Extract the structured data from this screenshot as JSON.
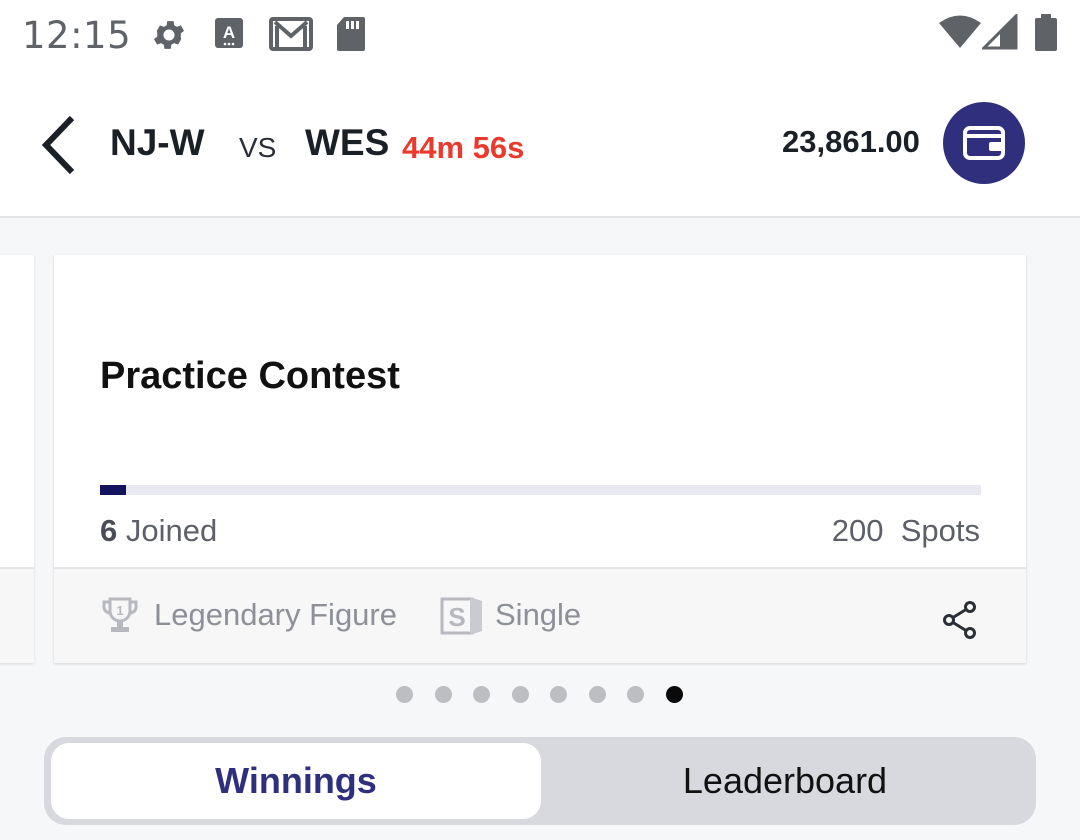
{
  "status_bar": {
    "time": "12:15",
    "icons": [
      "settings-icon",
      "keyboard-a-icon",
      "gmail-icon",
      "sd-card-icon",
      "wifi-icon",
      "signal-icon",
      "battery-icon"
    ]
  },
  "header": {
    "team_home": "NJ-W",
    "vs": "VS",
    "team_away": "WES",
    "countdown": "44m 56s",
    "balance": "23,861.00",
    "back_icon": "chevron-left-icon",
    "wallet_icon": "wallet-icon"
  },
  "contest": {
    "title": "Practice Contest",
    "joined_count": "6",
    "joined_label": "Joined",
    "spots_count": "200",
    "spots_label": "Spots",
    "fill_fraction": 0.03,
    "badge_1": "Legendary Figure",
    "badge_2": "Single",
    "badge_1_icon": "trophy-icon",
    "badge_2_icon": "single-entry-icon",
    "share_icon": "share-icon"
  },
  "pager": {
    "total": 8,
    "active_index": 7
  },
  "tabs": [
    {
      "label": "Winnings",
      "active": true
    },
    {
      "label": "Leaderboard",
      "active": false
    }
  ],
  "colors": {
    "accent": "#2f2f7e",
    "timer": "#ea3a2e",
    "progress": "#13135e"
  }
}
